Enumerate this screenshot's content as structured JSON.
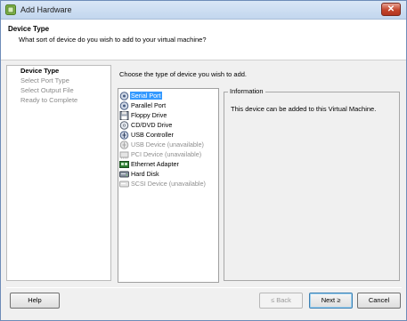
{
  "window": {
    "title": "Add Hardware",
    "close_label": "✕"
  },
  "header": {
    "title": "Device Type",
    "subtitle": "What sort of device do you wish to add to your virtual machine?"
  },
  "nav": {
    "items": [
      {
        "label": "Device Type",
        "active": true
      },
      {
        "label": "Select Port Type",
        "active": false
      },
      {
        "label": "Select Output File",
        "active": false
      },
      {
        "label": "Ready to Complete",
        "active": false
      }
    ]
  },
  "main": {
    "prompt": "Choose the type of device you wish to add."
  },
  "devices": [
    {
      "label": "Serial Port",
      "icon": "serial-port-icon",
      "selected": true,
      "enabled": true
    },
    {
      "label": "Parallel Port",
      "icon": "parallel-port-icon",
      "selected": false,
      "enabled": true
    },
    {
      "label": "Floppy Drive",
      "icon": "floppy-drive-icon",
      "selected": false,
      "enabled": true
    },
    {
      "label": "CD/DVD Drive",
      "icon": "cd-dvd-drive-icon",
      "selected": false,
      "enabled": true
    },
    {
      "label": "USB Controller",
      "icon": "usb-controller-icon",
      "selected": false,
      "enabled": true
    },
    {
      "label": "USB Device (unavailable)",
      "icon": "usb-device-icon",
      "selected": false,
      "enabled": false
    },
    {
      "label": "PCI Device (unavailable)",
      "icon": "pci-device-icon",
      "selected": false,
      "enabled": false
    },
    {
      "label": "Ethernet Adapter",
      "icon": "ethernet-adapter-icon",
      "selected": false,
      "enabled": true
    },
    {
      "label": "Hard Disk",
      "icon": "hard-disk-icon",
      "selected": false,
      "enabled": true
    },
    {
      "label": "SCSI Device (unavailable)",
      "icon": "scsi-device-icon",
      "selected": false,
      "enabled": false
    }
  ],
  "info": {
    "title": "Information",
    "text": "This device can be added to this Virtual Machine."
  },
  "buttons": {
    "help": "Help",
    "back": "≤ Back",
    "next": "Next ≥",
    "cancel": "Cancel"
  },
  "colors": {
    "selection": "#3399ff",
    "title_gradient_top": "#d9e6f6",
    "close_button": "#c4452c"
  }
}
